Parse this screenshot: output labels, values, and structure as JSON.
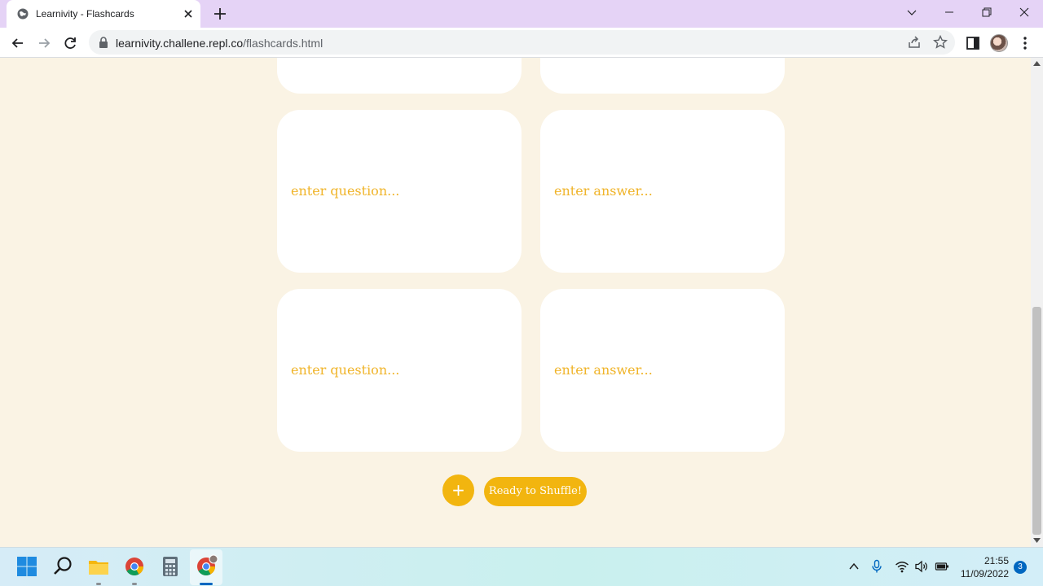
{
  "browser": {
    "tab_title": "Learnivity - Flashcards",
    "url_host": "learnivity.challene.repl.co",
    "url_path": "/flashcards.html"
  },
  "flashcards": [
    {
      "question": "",
      "answer": ""
    },
    {
      "question": "enter question...",
      "answer": "enter answer..."
    },
    {
      "question": "enter question...",
      "answer": "enter answer..."
    }
  ],
  "buttons": {
    "add_label": "+",
    "shuffle_label": "Ready to Shuffle!"
  },
  "colors": {
    "page_background": "#faf3e4",
    "accent": "#f2b50f",
    "placeholder_text": "#f0b429",
    "tab_strip": "#e5d3f6"
  },
  "taskbar": {
    "apps": [
      "windows-start-icon",
      "search-icon",
      "file-explorer-icon",
      "chrome-icon",
      "calculator-icon",
      "chrome-profile-icon"
    ],
    "time": "21:55",
    "date": "11/09/2022",
    "notification_count": "3"
  }
}
